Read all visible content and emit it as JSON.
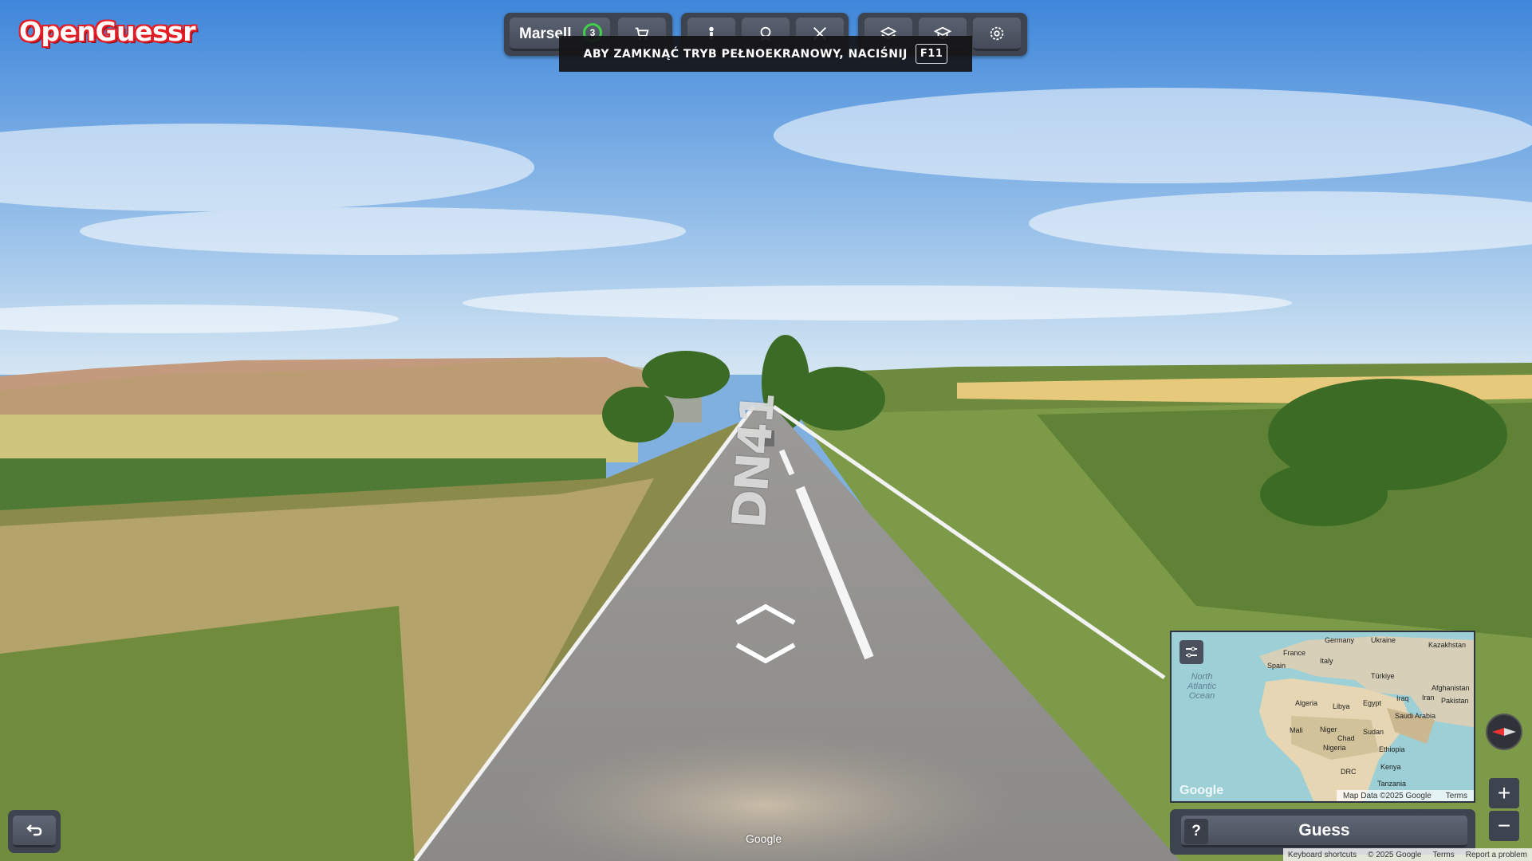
{
  "app": {
    "logo_text": "OpenGuessr",
    "brand_color": "#e51d24"
  },
  "toolbar": {
    "player_name": "Marsell",
    "round_counter": "3",
    "buttons": [
      {
        "name": "shop-icon"
      },
      {
        "name": "person-icon"
      },
      {
        "name": "badge-icon"
      },
      {
        "name": "crossed-swords-icon"
      },
      {
        "name": "layers-icon"
      },
      {
        "name": "graduation-cap-icon"
      },
      {
        "name": "gear-icon"
      }
    ]
  },
  "fullscreen_notice": {
    "text": "ABY ZAMKNĄĆ TRYB PEŁNOEKRANOWY, NACIŚNIJ",
    "key": "F11"
  },
  "street_view": {
    "road_marking": "DN41",
    "watermark": "Google"
  },
  "minimap": {
    "labels": [
      "Germany",
      "Ukraine",
      "Kazakhstan",
      "France",
      "Italy",
      "Spain",
      "Türkiye",
      "Algeria",
      "Libya",
      "Egypt",
      "Iraq",
      "Iran",
      "Afghanistan",
      "Pakistan",
      "Saudi Arabia",
      "Mali",
      "Niger",
      "Chad",
      "Sudan",
      "Nigeria",
      "Ethiopia",
      "Kenya",
      "DRC",
      "Tanzania"
    ],
    "ocean": "North\nAtlantic\nOcean",
    "map_data": "Map Data ©2025 Google",
    "terms": "Terms",
    "google_logo": "Google"
  },
  "guess": {
    "label": "Guess",
    "help": "?"
  },
  "controls": {
    "zoom_in": "+",
    "zoom_out": "−"
  },
  "attribution": {
    "keyboard": "Keyboard shortcuts",
    "copyright": "© 2025 Google",
    "terms": "Terms",
    "report": "Report a problem"
  }
}
